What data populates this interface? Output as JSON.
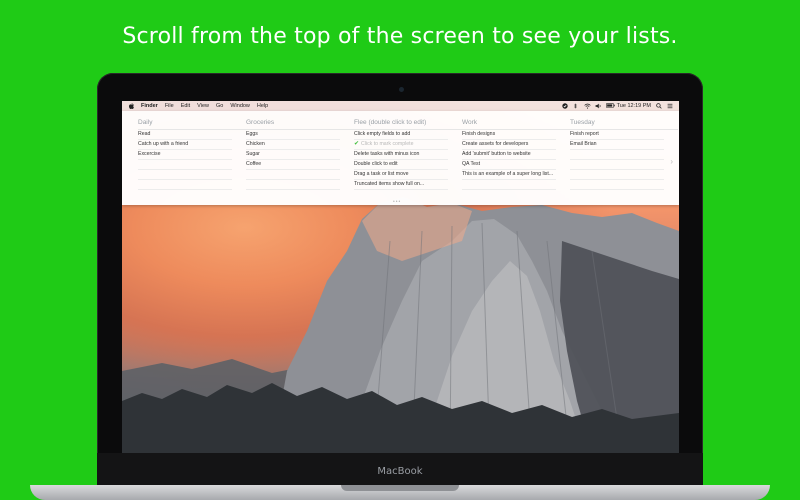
{
  "headline": "Scroll from the top of the screen to see your lists.",
  "device_label": "MacBook",
  "menubar": {
    "app": "Finder",
    "menus": [
      "File",
      "Edit",
      "View",
      "Go",
      "Window",
      "Help"
    ],
    "clock": "Tue 12:19 PM"
  },
  "lists": [
    {
      "title": "Daily",
      "items": [
        {
          "text": "Read",
          "done": false
        },
        {
          "text": "Catch up with a friend",
          "done": false
        },
        {
          "text": "Excercise",
          "done": false
        }
      ]
    },
    {
      "title": "Groceries",
      "items": [
        {
          "text": "Eggs",
          "done": false
        },
        {
          "text": "Chicken",
          "done": false
        },
        {
          "text": "Sugar",
          "done": false
        },
        {
          "text": "Coffee",
          "done": false
        }
      ]
    },
    {
      "title": "Flee (double click to edit)",
      "items": [
        {
          "text": "Click empty fields to add",
          "done": false
        },
        {
          "text": "Click to mark complete",
          "done": true
        },
        {
          "text": "Delete tasks with minus icon",
          "done": false
        },
        {
          "text": "Double click to edit",
          "done": false
        },
        {
          "text": "Drag a task or list move",
          "done": false
        },
        {
          "text": "Truncated items show full on...",
          "done": false
        }
      ]
    },
    {
      "title": "Work",
      "items": [
        {
          "text": "Finish designs",
          "done": false
        },
        {
          "text": "Create assets for developers",
          "done": false
        },
        {
          "text": "Add 'submit' button to website",
          "done": false
        },
        {
          "text": "QA Test",
          "done": false
        },
        {
          "text": "This is an example of a super long list...",
          "done": false
        }
      ]
    },
    {
      "title": "Tuesday",
      "items": [
        {
          "text": "Finish report",
          "done": false
        },
        {
          "text": "Email Brian",
          "done": false
        }
      ]
    }
  ],
  "icons": {
    "apple": "apple-icon",
    "next": "chevron-right-icon",
    "check": "checkmark-icon"
  },
  "colors": {
    "background": "#1fcb16",
    "check": "#3fbf3a"
  }
}
